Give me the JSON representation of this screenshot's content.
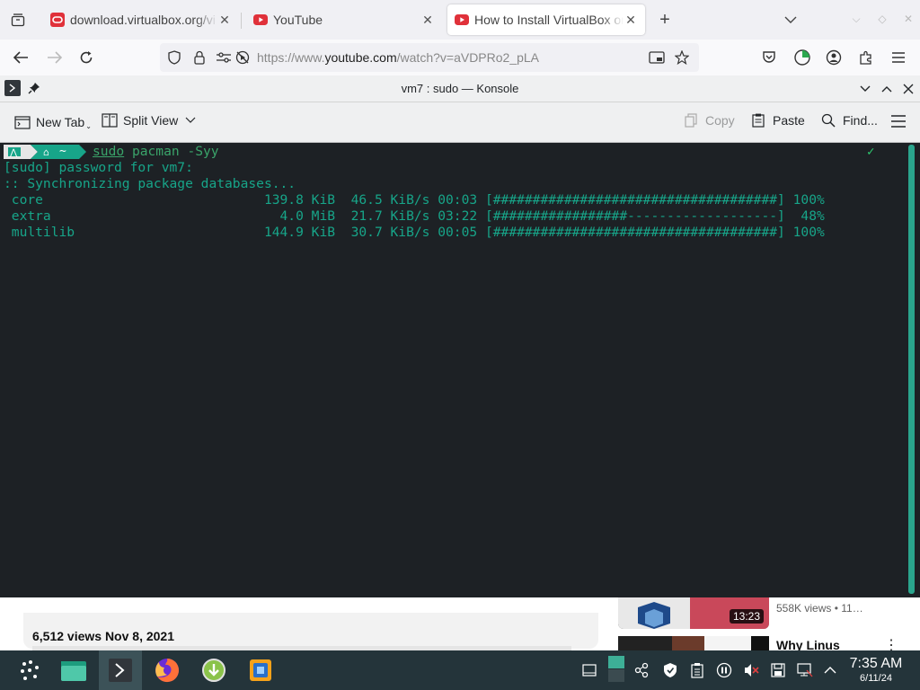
{
  "browser": {
    "tabs": [
      {
        "title": "download.virtualbox.org/vi",
        "favicon": "oracle-icon",
        "active": false
      },
      {
        "title": "YouTube",
        "favicon": "youtube-icon",
        "active": false
      },
      {
        "title": "How to Install VirtualBox on",
        "favicon": "youtube-icon",
        "active": true
      }
    ],
    "url_prefix": "https://www.",
    "url_domain": "youtube.com",
    "url_path": "/watch?v=aVDPRo2_pLA"
  },
  "page": {
    "views": "6,512 views  Nov 8, 2021",
    "related_meta": "558K views  • 11…",
    "related_duration": "13:23",
    "related_title": "Why Linus"
  },
  "konsole": {
    "title": "vm7 : sudo — Konsole",
    "toolbar": {
      "new_tab": "New Tab",
      "split_view": "Split View",
      "copy": "Copy",
      "paste": "Paste",
      "find": "Find..."
    },
    "prompt": {
      "home": "~",
      "cmd_sudo": "sudo",
      "cmd_rest": " pacman -Syy",
      "status": "✓"
    },
    "output": [
      "[sudo] password for vm7:",
      ":: Synchronizing package databases...",
      " core                            139.8 KiB  46.5 KiB/s 00:03 [####################################] 100%",
      " extra                             4.0 MiB  21.7 KiB/s 03:22 [#################-------------------]  48%",
      " multilib                        144.9 KiB  30.7 KiB/s 00:05 [####################################] 100%"
    ],
    "progress": [
      {
        "name": "core",
        "percent": 100
      },
      {
        "name": "extra",
        "percent": 48
      },
      {
        "name": "multilib",
        "percent": 100
      }
    ]
  },
  "taskbar": {
    "time": "7:35 AM",
    "date": "6/11/24"
  },
  "colors": {
    "terminal_bg": "#1d2125",
    "terminal_fg": "#17a589",
    "taskbar_bg": "#24343a",
    "accent_red": "#e0313a"
  }
}
